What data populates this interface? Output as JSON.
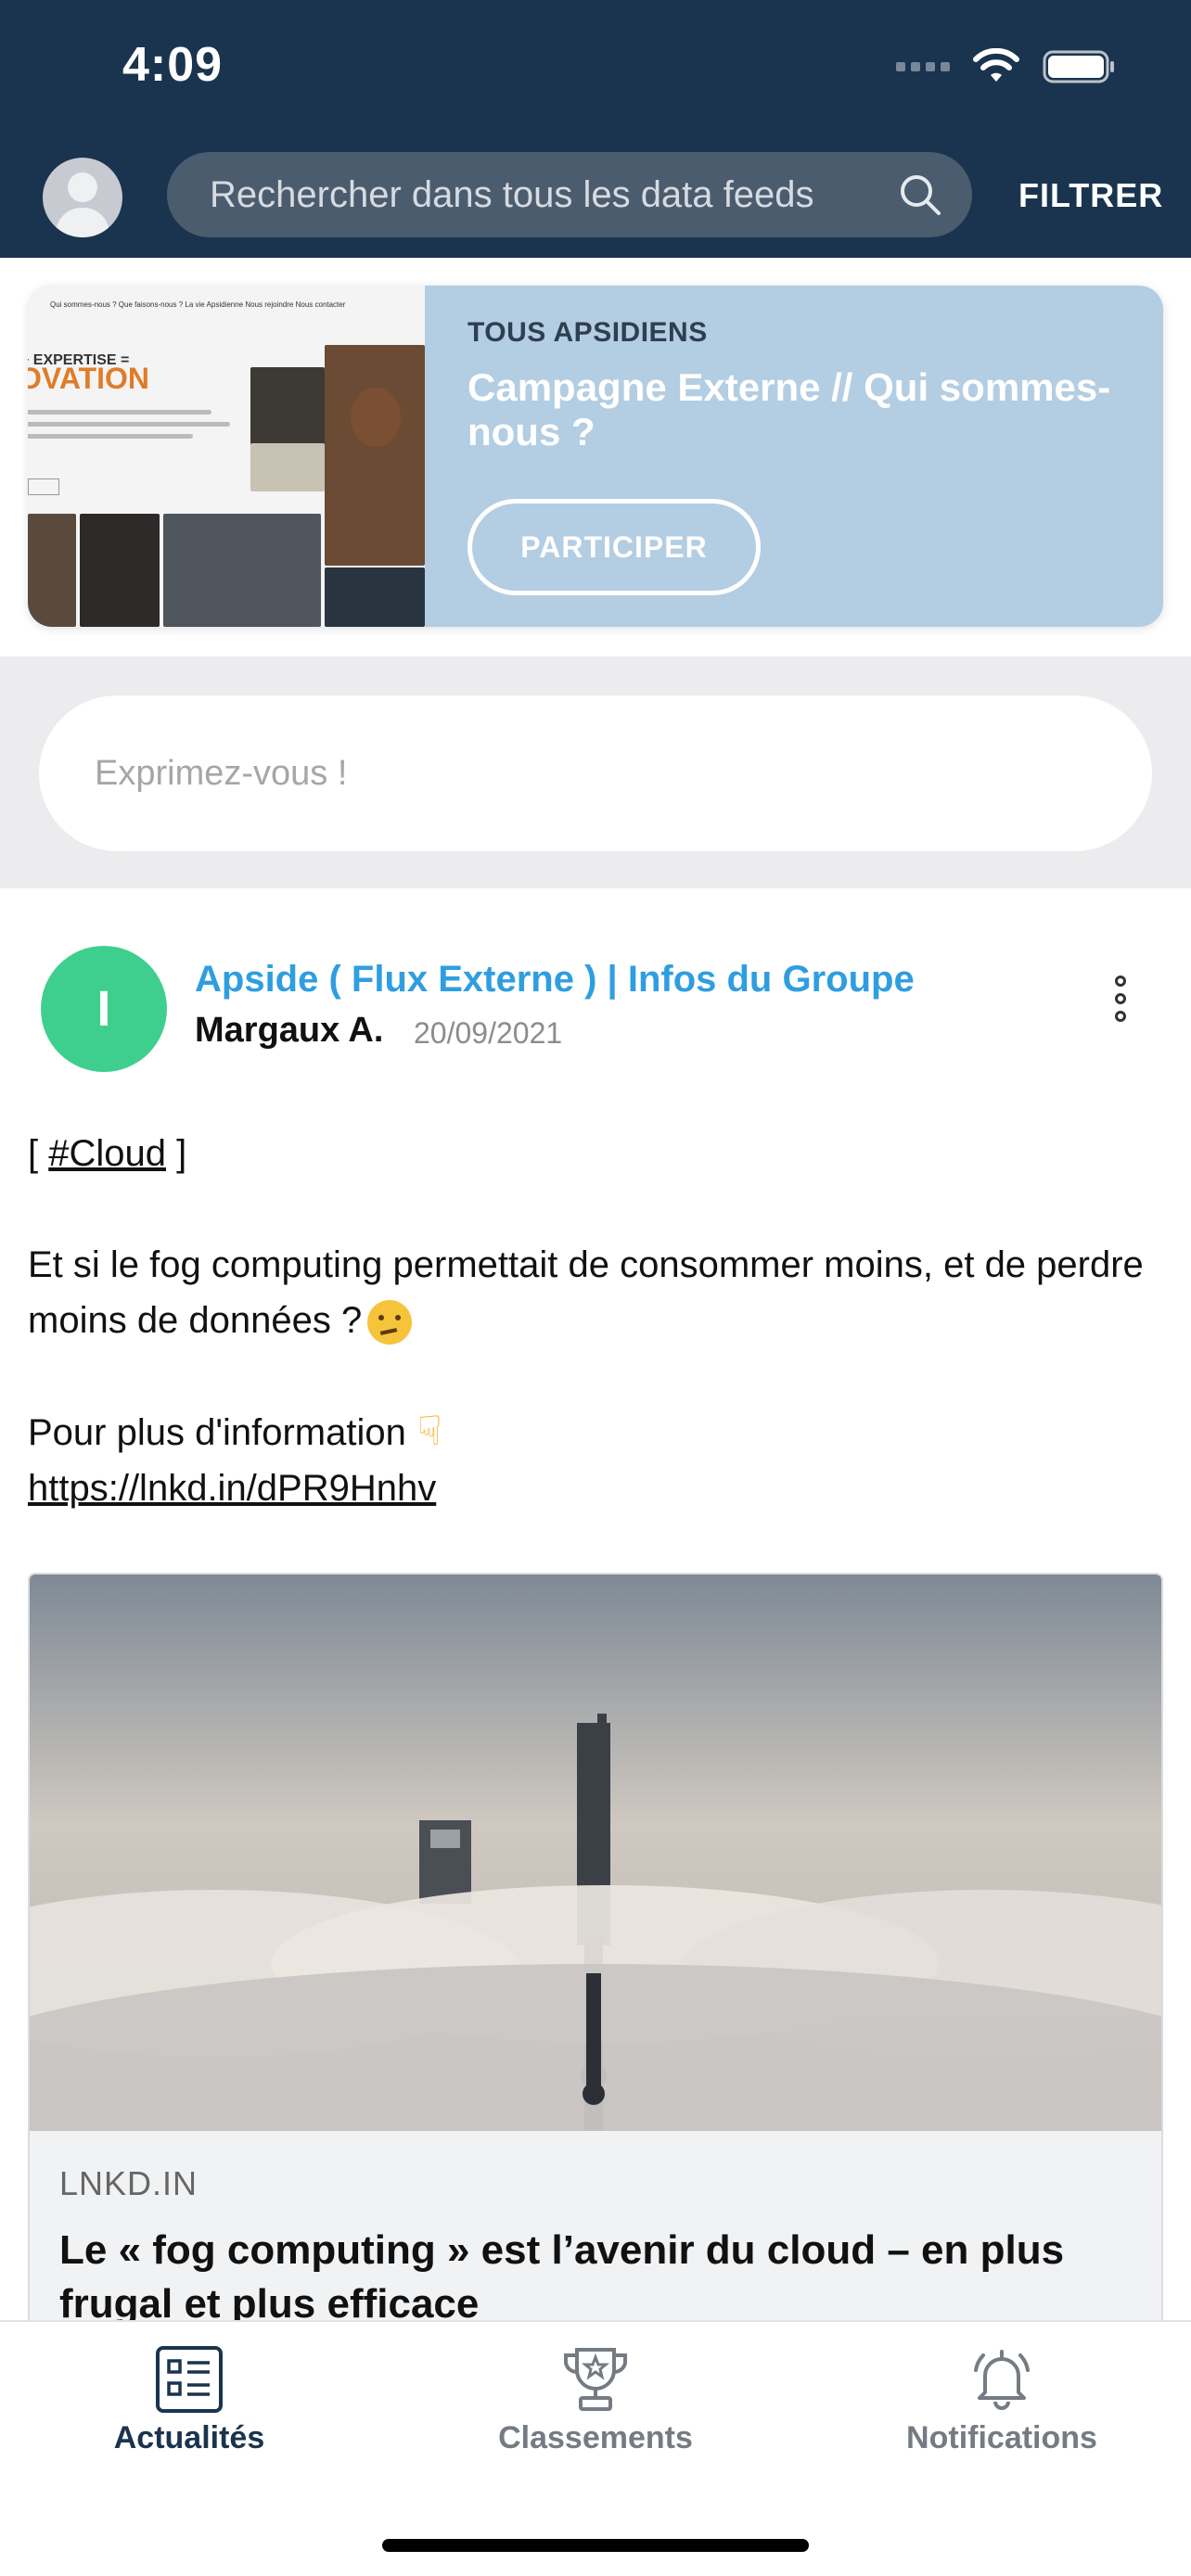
{
  "status_bar": {
    "time": "4:09"
  },
  "header": {
    "search_placeholder": "Rechercher dans tous les data feeds",
    "filter_label": "FILTRER"
  },
  "campaign": {
    "tag": "TOUS APSIDIENS",
    "title": "Campagne Externe // Qui sommes-nous ?",
    "button_label": "PARTICIPER",
    "thumbnail": {
      "nav": "Qui sommes-nous ?   Que faisons-nous ?   La vie Apsidienne   Nous rejoindre   Nous contacter",
      "plus_line": "+ EXPERTISE =",
      "headline": "OVATION"
    }
  },
  "compose": {
    "placeholder": "Exprimez-vous !"
  },
  "post": {
    "avatar_letter": "I",
    "source": "Apside ( Flux Externe ) | Infos du Groupe",
    "author": "Margaux A.",
    "date": "20/09/2021",
    "tag_open": "[ ",
    "tag": "#Cloud",
    "tag_close": " ]",
    "text": "Et si le fog computing permettait de consommer moins, et de perdre moins de données ?",
    "info_text": "Pour plus d'information",
    "link": "https://lnkd.in/dPR9Hnhv",
    "card": {
      "domain": "LNKD.IN",
      "title": "Le « fog computing » est l’avenir du cloud – en plus frugal et plus efficace"
    }
  },
  "bottom_nav": {
    "items": [
      {
        "label": "Actualités",
        "icon": "news-list-icon",
        "active": true
      },
      {
        "label": "Classements",
        "icon": "trophy-icon",
        "active": false
      },
      {
        "label": "Notifications",
        "icon": "bell-icon",
        "active": false
      }
    ]
  },
  "colors": {
    "header": "#1a344f",
    "accent_blue": "#2f9ee0",
    "avatar_green": "#3ecf8e",
    "campaign_bg": "#b3cde3"
  }
}
